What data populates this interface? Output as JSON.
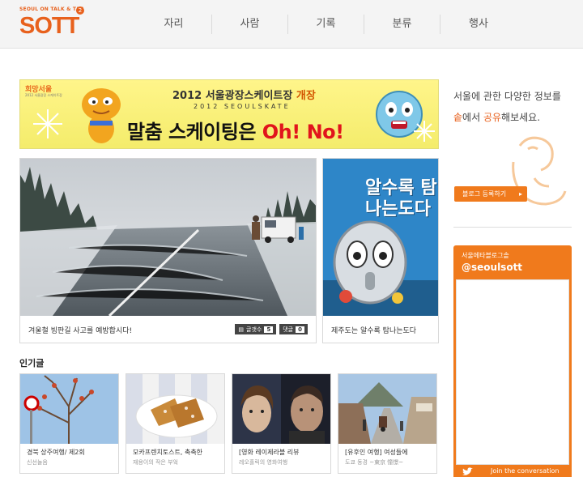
{
  "header": {
    "logo_tagline": "SEOUL ON TALK & TAG",
    "logo_word": "SOTT",
    "logo_badge": "2",
    "nav": [
      "자리",
      "사람",
      "기록",
      "분류",
      "행사"
    ]
  },
  "banner": {
    "brand": "희망서울",
    "brand_sub": "2012 서울광장 스케이트장",
    "title_prefix": "2012 서울광장스케이트장",
    "title_highlight": "개장",
    "subtitle": "2012 SEOULSKATE",
    "slogan_prefix": "말춤 스케이팅은",
    "slogan_highlight": "Oh! No!"
  },
  "sidebar": {
    "tagline_line1": "서울에 관한 다양한 정보를",
    "tagline_orange1": "솥",
    "tagline_mid": "에서 ",
    "tagline_orange2": "공유",
    "tagline_end": "해보세요.",
    "register_button": "블로그 등록하기",
    "twitter_label": "서울메타블로그솥",
    "twitter_handle": "@seoulsott",
    "twitter_join": "Join the conversation"
  },
  "featured": {
    "main_caption": "겨울철 빙판길 사고를 예방합시다!",
    "main_comment_label": "글갯수",
    "main_comment_count": "5",
    "main_reply_label": "댓글",
    "main_reply_count": "0",
    "side_caption": "제주도는 알수록 탐나는도다",
    "side_poster_text": "알수록 탐나는도다"
  },
  "popular": {
    "title": "인기글",
    "items": [
      {
        "title": "경북 상주여행/ 제2회",
        "sub": "신선놀음"
      },
      {
        "title": "모카프렌치토스트, 촉촉한",
        "sub": "재용이의 작은 부엌"
      },
      {
        "title": "[영화 레이제라블 리뷰",
        "sub": "레오홀릭의 영화여행"
      },
      {
        "title": "[유후인 여행] 여성들에",
        "sub": "도쿄 동경 ~東京 憧憬~"
      }
    ]
  },
  "colors": {
    "accent": "#f07a1c",
    "logo": "#e8611d",
    "banner_bg": "#fff58a",
    "slogan_red": "#e1141c"
  }
}
